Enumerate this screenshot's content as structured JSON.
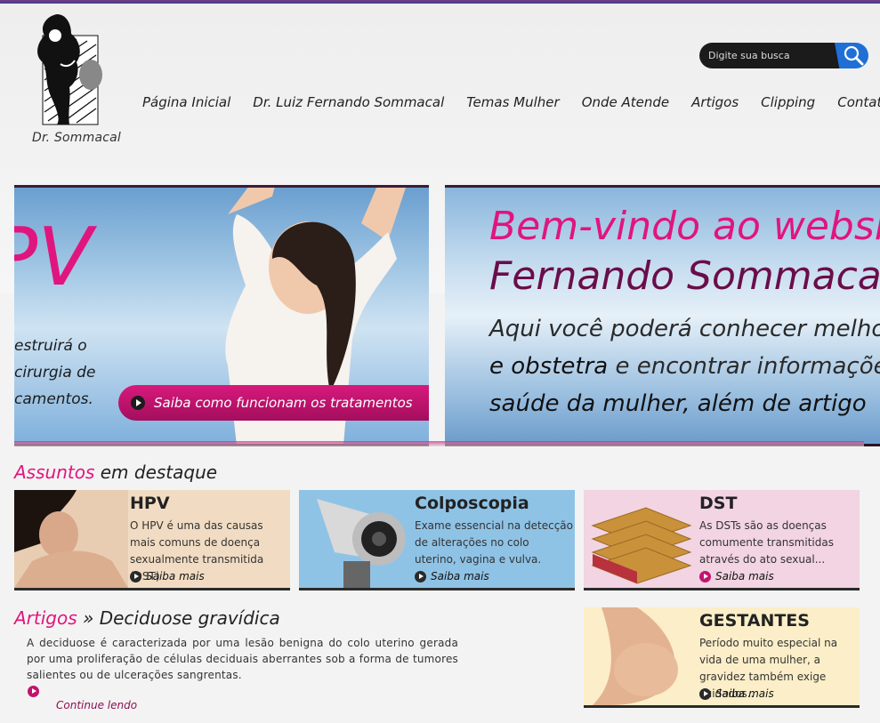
{
  "header": {
    "logo_text": "Dr. Sommacal",
    "search_placeholder": "Digite sua busca"
  },
  "nav": {
    "items": [
      "Página Inicial",
      "Dr. Luiz Fernando Sommacal",
      "Temas Mulher",
      "Onde Atende",
      "Artigos",
      "Clipping",
      "Contato"
    ]
  },
  "banner_left": {
    "big_text": "PV",
    "line1": "estruirá o",
    "line2": "cirurgia de",
    "line3": "camentos.",
    "cta_label": "Saiba como funcionam os tratamentos"
  },
  "banner_right": {
    "title1": "Bem-vindo ao websit",
    "title2": "Fernando Sommaca",
    "line1": "Aqui você poderá conhecer melho",
    "line2_bold": "e obstetra",
    "line2_rest": " e encontrar informações",
    "line3": "saúde da mulher, além de artigo"
  },
  "featured": {
    "heading_accent": "Assuntos",
    "heading_rest": " em destaque",
    "more_label": "Saiba mais",
    "cards": [
      {
        "title": "HPV",
        "desc": "O HPV é uma das causas mais comuns de doença sexualmente transmitida (DST)",
        "bg": "#f1dcc3"
      },
      {
        "title": "Colposcopia",
        "desc": "Exame essencial na detecção de alterações no colo uterino, vagina e vulva.",
        "bg": "#8fc3e6"
      },
      {
        "title": "DST",
        "desc": "As DSTs são as doenças comumente transmitidas através do ato sexual...",
        "bg": "#f2d4e2"
      },
      {
        "title": "GESTANTES",
        "desc": "Período muito especial na vida de uma mulher, a gravidez também exige cuidados..",
        "bg": "#fbeec8"
      }
    ]
  },
  "artigos": {
    "heading_accent": "Artigos",
    "heading_sep": " » ",
    "heading_title": "Deciduose gravídica",
    "text": "A deciduose é caracterizada por uma lesão benigna do colo uterino gerada por uma proliferação de células deciduais aberrantes sob a forma de tumores salientes ou de ulcerações sangrentas.",
    "continue_label": "Continue lendo"
  }
}
